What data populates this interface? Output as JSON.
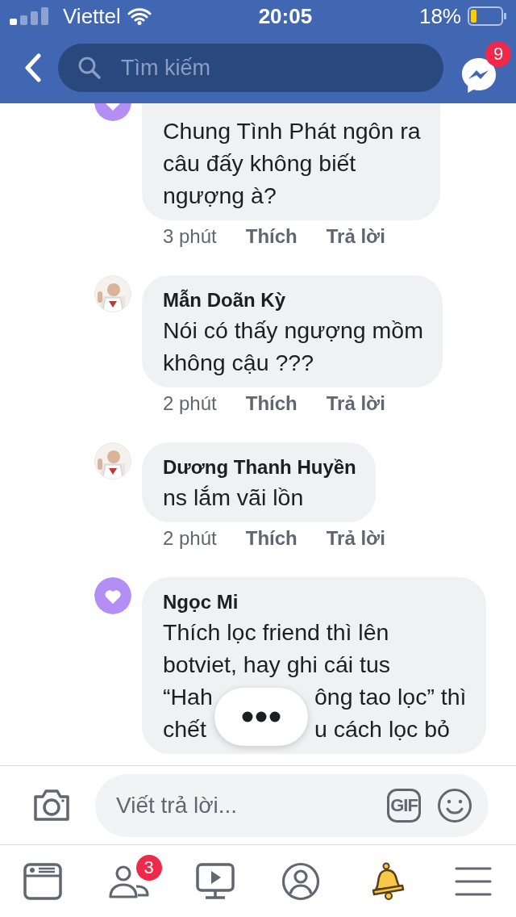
{
  "status_bar": {
    "carrier": "Viettel",
    "time": "20:05",
    "battery": "18%"
  },
  "header": {
    "search": {
      "placeholder": "Tìm kiếm"
    },
    "messages_badge": "9"
  },
  "comments": [
    {
      "avatar": {
        "kind": "heart"
      },
      "lines": [
        [
          "Chung Tình Phát ngôn ra"
        ],
        [
          "câu đấy không biết"
        ],
        [
          "ngượng à?"
        ]
      ],
      "time": "3 phút",
      "like": "Thích",
      "reply": "Trả lời"
    },
    {
      "avatar": {
        "kind": "picture"
      },
      "name": "Mẫn Doãn Kỳ",
      "lines": [
        [
          "Nói có thấy ngượng mồm"
        ],
        [
          "không cậu ???"
        ]
      ],
      "time": "2 phút",
      "like": "Thích",
      "reply": "Trả lời"
    },
    {
      "avatar": {
        "kind": "picture"
      },
      "name": "Dương Thanh Huyền",
      "lines": [
        [
          "ns lắm vãi lồn"
        ]
      ],
      "time": "2 phút",
      "like": "Thích",
      "reply": "Trả lời"
    },
    {
      "avatar": {
        "kind": "heart"
      },
      "name": "Ngọc Mi",
      "lines": [
        [
          "Thích lọc friend thì lên"
        ],
        [
          "botviet, hay ghi cái tus"
        ],
        [
          "“Hah",
          "ông tao lọc” thì"
        ],
        [
          "chết",
          "u cách lọc bỏ"
        ]
      ]
    }
  ],
  "composer": {
    "placeholder": "Viết trả lời...",
    "gif": "GIF"
  },
  "tabs": [
    {
      "kind": "feed",
      "selected": false
    },
    {
      "kind": "friends",
      "selected": false,
      "badge": "3"
    },
    {
      "kind": "watch",
      "selected": false
    },
    {
      "kind": "profile",
      "selected": false
    },
    {
      "kind": "notifications",
      "selected": true
    },
    {
      "kind": "menu",
      "selected": false
    }
  ]
}
